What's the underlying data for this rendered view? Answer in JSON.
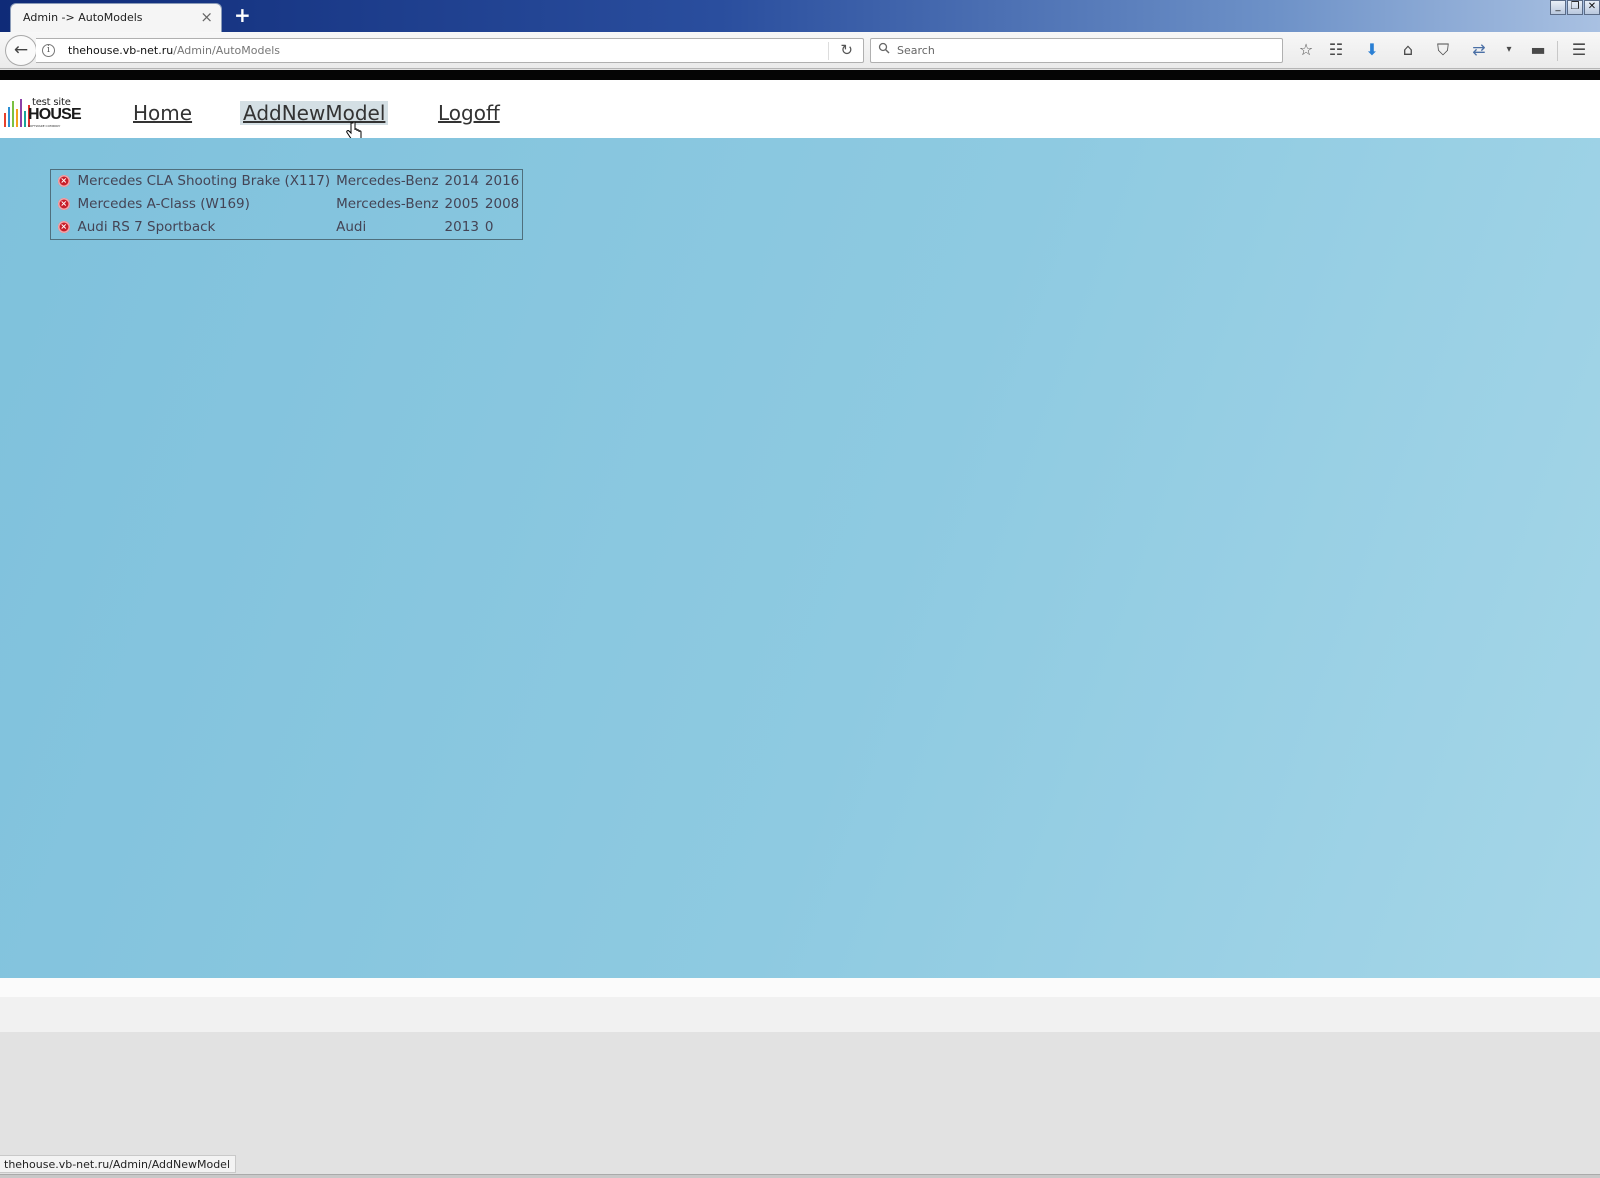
{
  "browser": {
    "tab_title": "Admin -> AutoModels",
    "tab_close": "×",
    "new_tab": "+",
    "url_host": "thehouse.vb-net.ru",
    "url_path": "/Admin/AutoModels",
    "search_placeholder": "Search",
    "window_controls": [
      "_",
      "❐",
      "✕"
    ],
    "toolbar_icons": [
      "star-icon",
      "reading-list-icon",
      "download-icon",
      "home-icon",
      "pocket-icon",
      "sync-icon",
      "dropdown-icon",
      "chat-icon",
      "menu-icon"
    ]
  },
  "site": {
    "logo": {
      "small": "test site",
      "big": "HOUSE",
      "tiny": "SOFTWARE COMPANY"
    },
    "nav": [
      {
        "label": "Home"
      },
      {
        "label": "AddNewModel"
      },
      {
        "label": "Logoff"
      }
    ]
  },
  "models": [
    {
      "name": "Mercedes CLA Shooting Brake (X117)",
      "brand": "Mercedes-Benz",
      "year_from": "2014",
      "year_to": "2016"
    },
    {
      "name": "Mercedes A-Class (W169)",
      "brand": "Mercedes-Benz",
      "year_from": "2005",
      "year_to": "2008"
    },
    {
      "name": "Audi RS 7 Sportback",
      "brand": "Audi",
      "year_from": "2013",
      "year_to": "0"
    }
  ],
  "status_bar": {
    "text": "thehouse.vb-net.ru/Admin/AddNewModel"
  },
  "colors": {
    "content_bg": "#8ecae1",
    "delete_icon": "#c81e2a",
    "titlebar": "#2a4e9e"
  }
}
